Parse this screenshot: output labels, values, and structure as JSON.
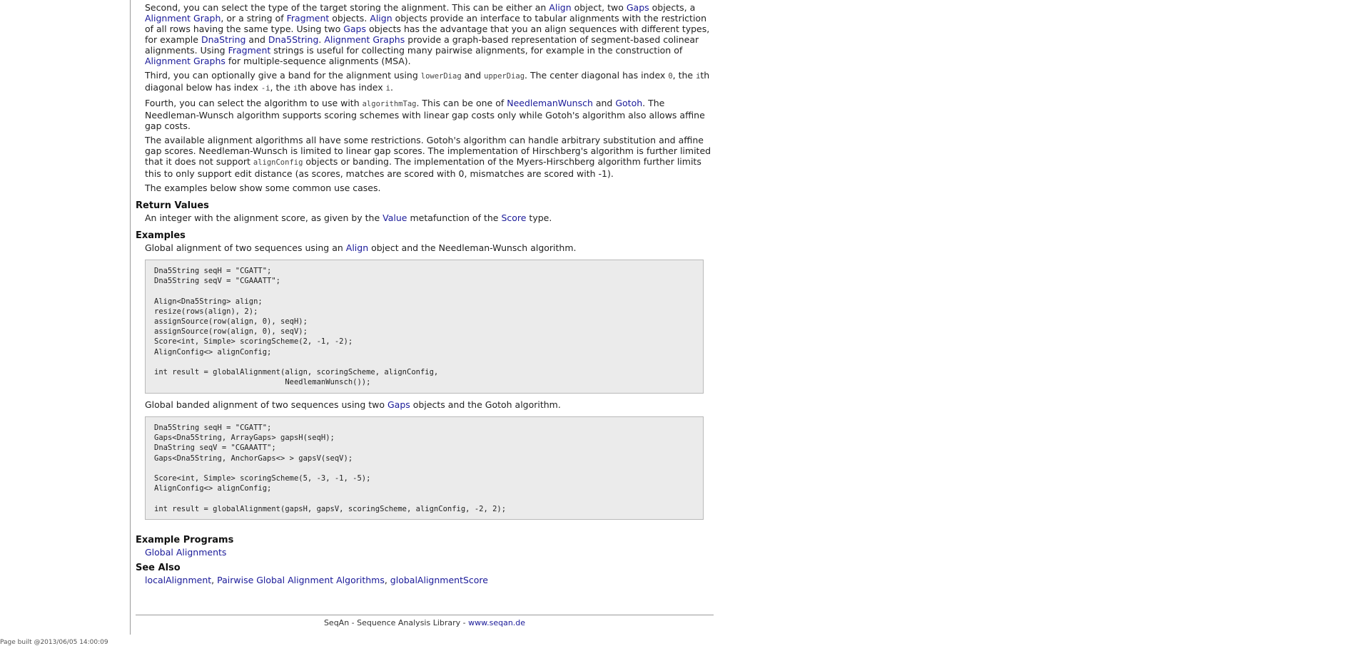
{
  "para_second": {
    "t1": "Second, you can select the type of the target storing the alignment. This can be either an ",
    "l1": "Align",
    "t2": " object, two ",
    "l2": "Gaps",
    "t3": " objects, a ",
    "l3": "Alignment Graph",
    "t4": ", or a string of ",
    "l4": "Fragment",
    "t5": " objects. ",
    "l5": "Align",
    "t6": " objects provide an interface to tabular alignments with the restriction of all rows having the same type. Using two ",
    "l6": "Gaps",
    "t7": " objects has the advantage that you an align sequences with different types, for example ",
    "l7": "DnaString",
    "t8": " and ",
    "l8": "Dna5String",
    "t9": ". ",
    "l9": "Alignment Graphs",
    "t10": " provide a graph-based representation of segment-based colinear alignments. Using ",
    "l10": "Fragment",
    "t11": " strings is useful for collecting many pairwise alignments, for example in the construction of ",
    "l11": "Alignment Graphs",
    "t12": " for multiple-sequence alignments (MSA)."
  },
  "para_third": {
    "t1": "Third, you can optionally give a band for the alignment using ",
    "c1": "lowerDiag",
    "t2": " and ",
    "c2": "upperDiag",
    "t3": ". The center diagonal has index ",
    "c3": "0",
    "t4": ", the ",
    "c4": "i",
    "t5": "th diagonal below has index ",
    "c5": "-i",
    "t6": ", the ",
    "c6": "i",
    "t7": "th above has index ",
    "c7": "i",
    "t8": "."
  },
  "para_fourth": {
    "t1": "Fourth, you can select the algorithm to use with ",
    "c1": "algorithmTag",
    "t2": ". This can be one of ",
    "l1": "NeedlemanWunsch",
    "t3": " and ",
    "l2": "Gotoh",
    "t4": ". The Needleman-Wunsch algorithm supports scoring schemes with linear gap costs only while Gotoh's algorithm also allows affine gap costs."
  },
  "para_restrictions": {
    "t1": "The available alignment algorithms all have some restrictions. Gotoh's algorithm can handle arbitrary substitution and affine gap scores. Needleman-Wunsch is limited to linear gap scores. The implementation of Hirschberg's algorithm is further limited that it does not support ",
    "c1": "alignConfig",
    "t2": " objects or banding. The implementation of the Myers-Hirschberg algorithm further limits this to only support edit distance (as scores, matches are scored with 0, mismatches are scored with -1)."
  },
  "para_examples_below": "The examples below show some common use cases.",
  "return_values": {
    "heading": "Return Values",
    "t1": "An integer with the alignment score, as given by the ",
    "l1": "Value",
    "t2": " metafunction of the ",
    "l2": "Score",
    "t3": " type."
  },
  "examples": {
    "heading": "Examples",
    "ex1_t1": "Global alignment of two sequences using an ",
    "ex1_l1": "Align",
    "ex1_t2": " object and the Needleman-Wunsch algorithm.",
    "code1": "Dna5String seqH = \"CGATT\";\nDna5String seqV = \"CGAAATT\";\n\nAlign<Dna5String> align;\nresize(rows(align), 2);\nassignSource(row(align, 0), seqH);\nassignSource(row(align, 0), seqV);\nScore<int, Simple> scoringScheme(2, -1, -2);\nAlignConfig<> alignConfig;\n\nint result = globalAlignment(align, scoringScheme, alignConfig,\n                             NeedlemanWunsch());",
    "ex2_t1": "Global banded alignment of two sequences using two ",
    "ex2_l1": "Gaps",
    "ex2_t2": " objects and the Gotoh algorithm.",
    "code2": "Dna5String seqH = \"CGATT\";\nGaps<Dna5String, ArrayGaps> gapsH(seqH);\nDnaString seqV = \"CGAAATT\";\nGaps<Dna5String, AnchorGaps<> > gapsV(seqV);\n\nScore<int, Simple> scoringScheme(5, -3, -1, -5);\nAlignConfig<> alignConfig;\n\nint result = globalAlignment(gapsH, gapsV, scoringScheme, alignConfig, -2, 2);"
  },
  "example_programs": {
    "heading": "Example Programs",
    "link": "Global Alignments"
  },
  "see_also": {
    "heading": "See Also",
    "link1": "localAlignment",
    "sep1": ", ",
    "link2": "Pairwise Global Alignment Algorithms",
    "sep2": ", ",
    "link3": "globalAlignmentScore"
  },
  "footer": {
    "text": "SeqAn - Sequence Analysis Library - ",
    "link": "www.seqan.de"
  },
  "page_built": "Page built @2013/06/05 14:00:09",
  "colors": {
    "link": "#1a1a99",
    "code_bg": "#ebebeb",
    "code_border": "#b9b9b9"
  }
}
